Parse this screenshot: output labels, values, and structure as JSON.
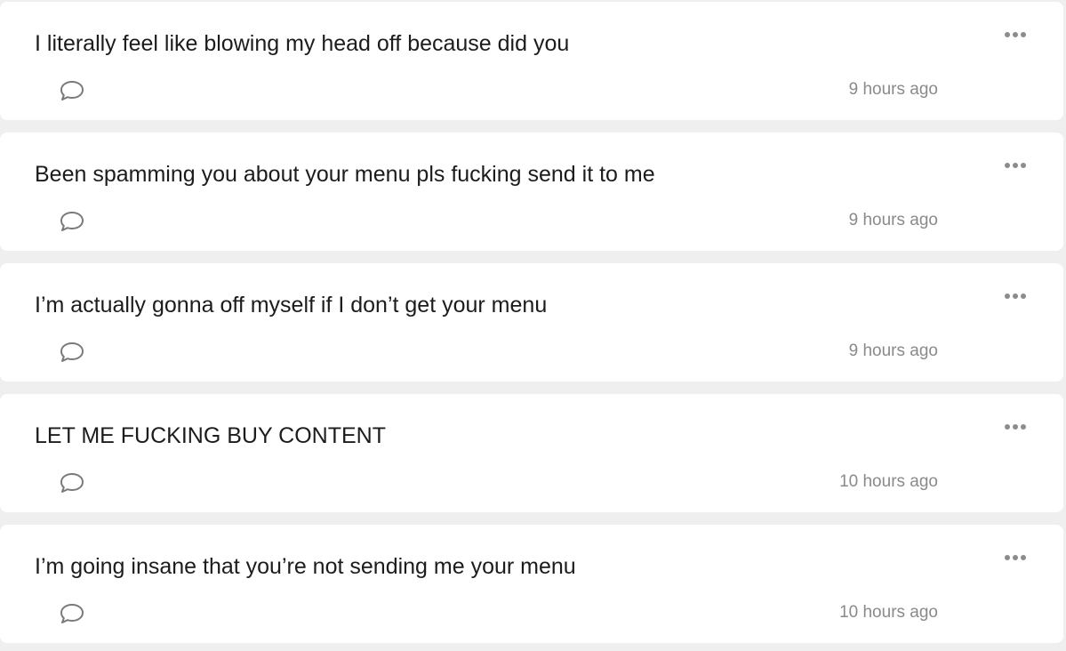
{
  "messages": [
    {
      "text": "I literally feel like blowing my head off because did you",
      "time": "9 hours ago"
    },
    {
      "text": "Been spamming you about your menu pls fucking send it to me",
      "time": "9 hours ago"
    },
    {
      "text": "I’m actually gonna off myself if I don’t get your menu",
      "time": "9 hours ago"
    },
    {
      "text": "LET ME FUCKING BUY CONTENT",
      "time": "10 hours ago"
    },
    {
      "text": "I’m going insane that you’re not sending me your menu",
      "time": "10 hours ago"
    }
  ],
  "icons": {
    "more": "ellipsis-icon",
    "comment": "speech-bubble-icon"
  },
  "colors": {
    "background": "#efefef",
    "card": "#ffffff",
    "text": "#1c1c1c",
    "muted": "#8a8a8a"
  }
}
